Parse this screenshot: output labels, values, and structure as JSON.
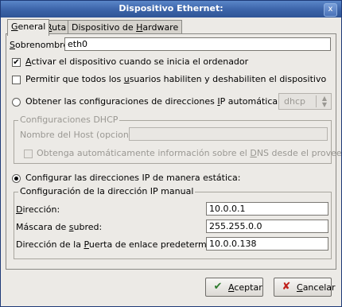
{
  "window": {
    "title": "Dispositivo Ethernet:",
    "close_glyph": "x"
  },
  "tabs": [
    {
      "pre": "",
      "key": "G",
      "post": "eneral"
    },
    {
      "pre": "",
      "key": "R",
      "post": "uta"
    },
    {
      "pre": "Dispositivo de ",
      "key": "H",
      "post": "ardware"
    }
  ],
  "general": {
    "nickname": {
      "pre": "",
      "key": "S",
      "post": "obrenombre:",
      "value": "eth0"
    },
    "activate": {
      "pre": "",
      "key": "A",
      "post": "ctivar el dispositivo cuando se inicia el ordenador",
      "checked": true
    },
    "allow_users": {
      "pre": "Permitir que todos los ",
      "key": "u",
      "post": "suarios habiliten y deshabiliten el dispositivo",
      "checked": false
    },
    "auto_ip": {
      "pre": "Obtener las configuraciones de direcciones ",
      "key": "I",
      "post": "P automáticamente con:",
      "selected": false,
      "combo_value": "dhcp"
    },
    "dhcp": {
      "frame_title": "Configuraciones DHCP",
      "host_label": "Nombre del Host (opcional):",
      "host_value": "",
      "dns": {
        "pre": "Obtenga automáticamente información sobre el ",
        "key": "D",
        "post": "NS desde el proveedor",
        "checked": false
      }
    },
    "static": {
      "radio": {
        "pre": "Configurar las direcciones IP de manera estática:",
        "selected": true
      },
      "frame_title": "Configuración de la dirección IP manual",
      "address": {
        "pre": "",
        "key": "D",
        "post": "irección:",
        "value": "10.0.0.1"
      },
      "netmask": {
        "pre": "Máscara de ",
        "key": "s",
        "post": "ubred:",
        "value": "255.255.0.0"
      },
      "gateway": {
        "pre": "Dirección de la ",
        "key": "P",
        "post": "uerta de enlace predeterminada:",
        "value": "10.0.0.138"
      }
    }
  },
  "buttons": {
    "ok": {
      "pre": "",
      "key": "A",
      "post": "ceptar",
      "icon": "check-icon"
    },
    "cancel": {
      "pre": "",
      "key": "C",
      "post": "ancelar",
      "icon": "cancel-icon"
    }
  }
}
